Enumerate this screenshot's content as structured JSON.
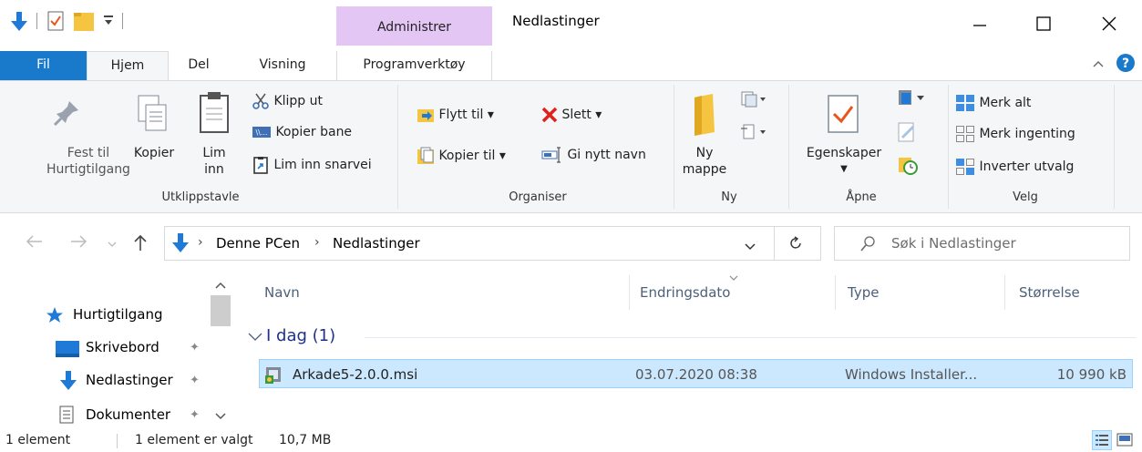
{
  "titlebar": {
    "contextual_tab_group": "Administrer",
    "window_title": "Nedlastinger"
  },
  "tabs": {
    "fil": "Fil",
    "hjem": "Hjem",
    "del": "Del",
    "visning": "Visning",
    "programverktoy": "Programverktøy"
  },
  "ribbon": {
    "clipboard": {
      "pin_label_1": "Fest til",
      "pin_label_2": "Hurtigtilgang",
      "copy": "Kopier",
      "paste_1": "Lim",
      "paste_2": "inn",
      "cut": "Klipp ut",
      "copy_path": "Kopier bane",
      "paste_shortcut": "Lim inn snarvei",
      "group_label": "Utklippstavle"
    },
    "organize": {
      "move_to": "Flytt til",
      "delete": "Slett",
      "copy_to": "Kopier til",
      "rename": "Gi nytt navn",
      "group_label": "Organiser"
    },
    "new": {
      "new_folder_1": "Ny",
      "new_folder_2": "mappe",
      "group_label": "Ny"
    },
    "open": {
      "properties": "Egenskaper",
      "group_label": "Åpne"
    },
    "select": {
      "select_all": "Merk alt",
      "select_none": "Merk ingenting",
      "invert": "Inverter utvalg",
      "group_label": "Velg"
    }
  },
  "address": {
    "crumb_1": "Denne PCen",
    "crumb_2": "Nedlastinger",
    "search_placeholder": "Søk i Nedlastinger"
  },
  "navpane": {
    "items": [
      {
        "label": "Hurtigtilgang"
      },
      {
        "label": "Skrivebord"
      },
      {
        "label": "Nedlastinger"
      },
      {
        "label": "Dokumenter"
      }
    ]
  },
  "filelist": {
    "columns": [
      "Navn",
      "Endringsdato",
      "Type",
      "Størrelse"
    ],
    "group_header": "I dag (1)",
    "rows": [
      {
        "name": "Arkade5-2.0.0.msi",
        "date": "03.07.2020 08:38",
        "type": "Windows Installer...",
        "size": "10 990 kB"
      }
    ]
  },
  "status": {
    "count": "1 element",
    "selected": "1 element er valgt",
    "size": "10,7 MB"
  },
  "colors": {
    "fil_tab": "#1979ca",
    "contextual_tab": "#e4c6f5",
    "selection": "#cce8ff",
    "selection_border": "#99d1ff",
    "folder": "#f5c542",
    "download_arrow": "#1e7ad6",
    "delete_red": "#e0211b"
  },
  "icons": [
    "download-icon",
    "properties-check-icon",
    "folder-icon",
    "pin-icon",
    "copy-icon",
    "paste-icon",
    "scissors-icon",
    "copy-path-icon",
    "paste-shortcut-icon",
    "move-to-icon",
    "delete-x-icon",
    "copy-to-icon",
    "rename-icon",
    "new-folder-icon",
    "new-item-icon",
    "easy-access-icon",
    "open-icon",
    "edit-icon",
    "history-icon",
    "select-all-icon",
    "select-none-icon",
    "invert-selection-icon",
    "back-icon",
    "forward-icon",
    "recent-icon",
    "up-icon",
    "refresh-icon",
    "search-icon",
    "star-icon",
    "desktop-icon",
    "document-icon",
    "msi-icon",
    "details-view-icon",
    "large-icons-view-icon",
    "help-icon"
  ]
}
